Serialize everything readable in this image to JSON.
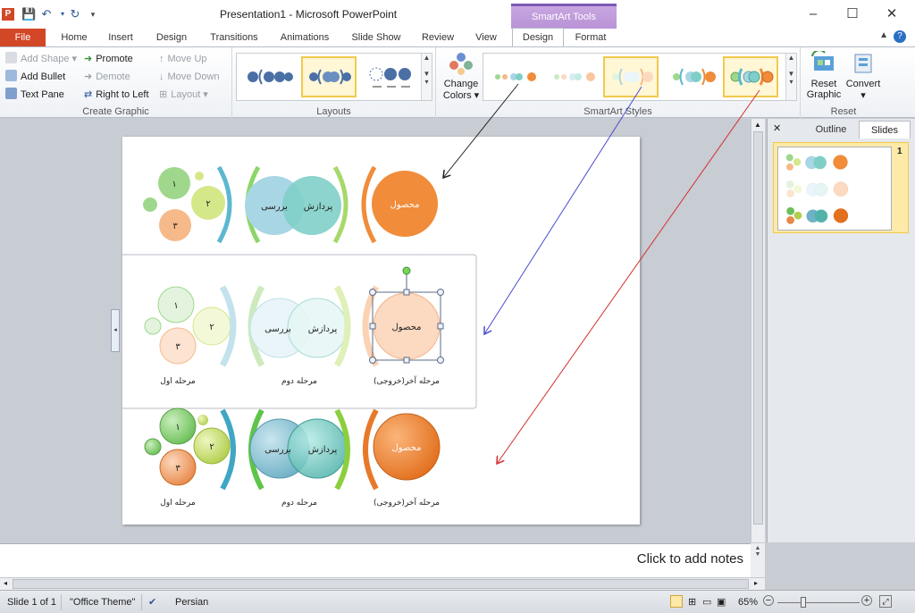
{
  "window": {
    "title": "Presentation1  -  Microsoft PowerPoint",
    "app_badge": "P",
    "context_group": "SmartArt Tools",
    "controls": [
      "–",
      "☐",
      "✕"
    ]
  },
  "tabs": {
    "file": "File",
    "items": [
      "Home",
      "Insert",
      "Design",
      "Transitions",
      "Animations",
      "Slide Show",
      "Review",
      "View",
      "Design",
      "Format"
    ],
    "active_index": 8,
    "help": "?"
  },
  "ribbon": {
    "create_graphic": {
      "label": "Create Graphic",
      "add_shape": "Add Shape",
      "add_bullet": "Add Bullet",
      "text_pane": "Text Pane",
      "promote": "Promote",
      "demote": "Demote",
      "right_to_left": "Right to Left",
      "move_up": "Move Up",
      "move_down": "Move Down",
      "layout": "Layout"
    },
    "layouts": {
      "label": "Layouts"
    },
    "styles": {
      "change_colors_1": "Change",
      "change_colors_2": "Colors",
      "label": "SmartArt Styles"
    },
    "reset": {
      "label": "Reset",
      "reset_graphic_1": "Reset",
      "reset_graphic_2": "Graphic",
      "convert": "Convert"
    }
  },
  "slide": {
    "stage1_nums": [
      "١",
      "٢",
      "٣"
    ],
    "stage2_left": "بررسی",
    "stage2_right": "پردازش",
    "stage3": "محصول",
    "label_stage1": "مرحله اول",
    "label_stage2": "مرحله دوم",
    "label_stage3": "مرحله آخر(خروجی)"
  },
  "right_pane": {
    "close": "✕",
    "outline_tab": "Outline",
    "slides_tab": "Slides",
    "slide_number": "1"
  },
  "notes": {
    "placeholder": "Click to add notes"
  },
  "status": {
    "slide_info": "Slide 1 of 1",
    "theme": "\"Office Theme\"",
    "language": "Persian",
    "zoom": "65%"
  },
  "colors": {
    "file_tab": "#d24726",
    "context_group": "#b993d6",
    "stage1_green": "#9fd88c",
    "stage1_lime": "#d4e88a",
    "stage1_peach": "#f6b98a",
    "stage2_blue": "#a9d6e4",
    "stage2_teal": "#7fcfc8",
    "stage3_orange": "#f08c3a",
    "arrow_black": "#222222",
    "arrow_blue": "#4a4ad0",
    "arrow_red": "#d33030"
  }
}
